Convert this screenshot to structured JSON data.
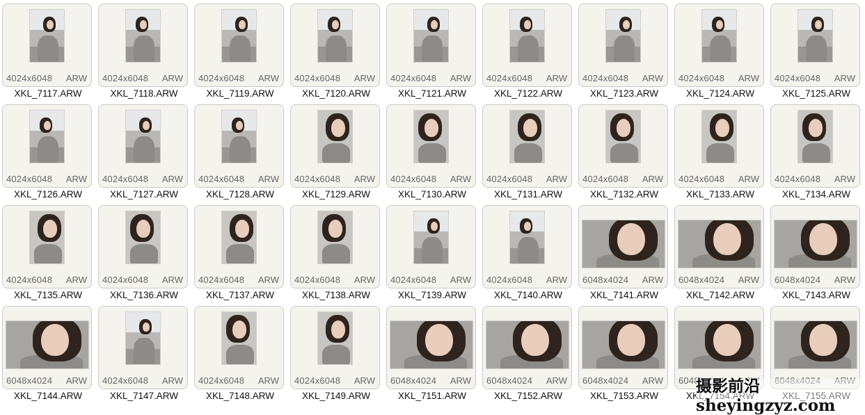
{
  "files": [
    {
      "name": "XKL_7117.ARW",
      "dims": "4024x6048",
      "format": "ARW",
      "orientation": "portrait",
      "scene": "street"
    },
    {
      "name": "XKL_7118.ARW",
      "dims": "4024x6048",
      "format": "ARW",
      "orientation": "portrait",
      "scene": "street"
    },
    {
      "name": "XKL_7119.ARW",
      "dims": "4024x6048",
      "format": "ARW",
      "orientation": "portrait",
      "scene": "street"
    },
    {
      "name": "XKL_7120.ARW",
      "dims": "4024x6048",
      "format": "ARW",
      "orientation": "portrait",
      "scene": "street"
    },
    {
      "name": "XKL_7121.ARW",
      "dims": "4024x6048",
      "format": "ARW",
      "orientation": "portrait",
      "scene": "street"
    },
    {
      "name": "XKL_7122.ARW",
      "dims": "4024x6048",
      "format": "ARW",
      "orientation": "portrait",
      "scene": "street"
    },
    {
      "name": "XKL_7123.ARW",
      "dims": "4024x6048",
      "format": "ARW",
      "orientation": "portrait",
      "scene": "street"
    },
    {
      "name": "XKL_7124.ARW",
      "dims": "4024x6048",
      "format": "ARW",
      "orientation": "portrait",
      "scene": "street"
    },
    {
      "name": "XKL_7125.ARW",
      "dims": "4024x6048",
      "format": "ARW",
      "orientation": "portrait",
      "scene": "street"
    },
    {
      "name": "XKL_7126.ARW",
      "dims": "4024x6048",
      "format": "ARW",
      "orientation": "portrait",
      "scene": "street"
    },
    {
      "name": "XKL_7127.ARW",
      "dims": "4024x6048",
      "format": "ARW",
      "orientation": "portrait",
      "scene": "street"
    },
    {
      "name": "XKL_7128.ARW",
      "dims": "4024x6048",
      "format": "ARW",
      "orientation": "portrait",
      "scene": "street"
    },
    {
      "name": "XKL_7129.ARW",
      "dims": "4024x6048",
      "format": "ARW",
      "orientation": "portrait",
      "scene": "closeup"
    },
    {
      "name": "XKL_7130.ARW",
      "dims": "4024x6048",
      "format": "ARW",
      "orientation": "portrait",
      "scene": "closeup"
    },
    {
      "name": "XKL_7131.ARW",
      "dims": "4024x6048",
      "format": "ARW",
      "orientation": "portrait",
      "scene": "closeup"
    },
    {
      "name": "XKL_7132.ARW",
      "dims": "4024x6048",
      "format": "ARW",
      "orientation": "portrait",
      "scene": "closeup"
    },
    {
      "name": "XKL_7133.ARW",
      "dims": "4024x6048",
      "format": "ARW",
      "orientation": "portrait",
      "scene": "closeup"
    },
    {
      "name": "XKL_7134.ARW",
      "dims": "4024x6048",
      "format": "ARW",
      "orientation": "portrait",
      "scene": "closeup"
    },
    {
      "name": "XKL_7135.ARW",
      "dims": "4024x6048",
      "format": "ARW",
      "orientation": "portrait",
      "scene": "closeup"
    },
    {
      "name": "XKL_7136.ARW",
      "dims": "4024x6048",
      "format": "ARW",
      "orientation": "portrait",
      "scene": "closeup"
    },
    {
      "name": "XKL_7137.ARW",
      "dims": "4024x6048",
      "format": "ARW",
      "orientation": "portrait",
      "scene": "closeup"
    },
    {
      "name": "XKL_7138.ARW",
      "dims": "4024x6048",
      "format": "ARW",
      "orientation": "portrait",
      "scene": "closeup"
    },
    {
      "name": "XKL_7139.ARW",
      "dims": "4024x6048",
      "format": "ARW",
      "orientation": "portrait",
      "scene": "street"
    },
    {
      "name": "XKL_7140.ARW",
      "dims": "4024x6048",
      "format": "ARW",
      "orientation": "portrait",
      "scene": "street"
    },
    {
      "name": "XKL_7141.ARW",
      "dims": "6048x4024",
      "format": "ARW",
      "orientation": "landscape",
      "scene": "closeup"
    },
    {
      "name": "XKL_7142.ARW",
      "dims": "6048x4024",
      "format": "ARW",
      "orientation": "landscape",
      "scene": "closeup"
    },
    {
      "name": "XKL_7143.ARW",
      "dims": "6048x4024",
      "format": "ARW",
      "orientation": "landscape",
      "scene": "closeup"
    },
    {
      "name": "XKL_7144.ARW",
      "dims": "6048x4024",
      "format": "ARW",
      "orientation": "landscape",
      "scene": "closeup"
    },
    {
      "name": "XKL_7147.ARW",
      "dims": "4024x6048",
      "format": "ARW",
      "orientation": "portrait",
      "scene": "street"
    },
    {
      "name": "XKL_7148.ARW",
      "dims": "4024x6048",
      "format": "ARW",
      "orientation": "portrait",
      "scene": "closeup"
    },
    {
      "name": "XKL_7149.ARW",
      "dims": "4024x6048",
      "format": "ARW",
      "orientation": "portrait",
      "scene": "closeup"
    },
    {
      "name": "XKL_7151.ARW",
      "dims": "6048x4024",
      "format": "ARW",
      "orientation": "landscape",
      "scene": "closeup"
    },
    {
      "name": "XKL_7152.ARW",
      "dims": "6048x4024",
      "format": "ARW",
      "orientation": "landscape",
      "scene": "closeup"
    },
    {
      "name": "XKL_7153.ARW",
      "dims": "6048x4024",
      "format": "ARW",
      "orientation": "landscape",
      "scene": "closeup"
    },
    {
      "name": "XKL_7154.ARW",
      "dims": "6048x4024",
      "format": "ARW",
      "orientation": "landscape",
      "scene": "closeup"
    },
    {
      "name": "XKL_7155.ARW",
      "dims": "6048x4024",
      "format": "ARW",
      "orientation": "landscape",
      "scene": "closeup"
    }
  ],
  "watermark": {
    "text": "摄影前沿 sheyingzyz.com"
  },
  "colors": {
    "card_bg": "#f4f3ee",
    "card_border": "#c9c9c4",
    "sweater": "#8d8b87",
    "hair": "#2e241d",
    "skin": "#e8cdbd",
    "sky": "#e6e8ea",
    "ground": "#9a9692",
    "text_meta": "#666666",
    "text_name": "#111111"
  }
}
